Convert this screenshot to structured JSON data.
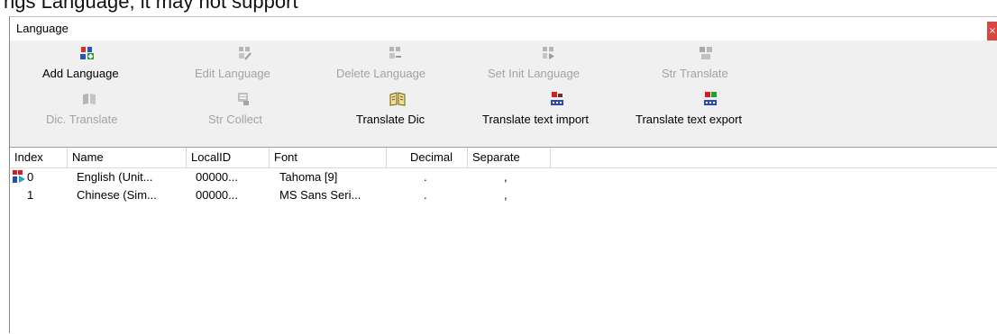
{
  "background_text": "ngs Language, it may not support",
  "window": {
    "title": "Language",
    "close_glyph": "×"
  },
  "toolbar": {
    "add_language": "Add Language",
    "edit_language": "Edit Language",
    "delete_language": "Delete Language",
    "set_init_language": "Set Init Language",
    "str_translate": "Str Translate",
    "dic_translate": "Dic. Translate",
    "str_collect": "Str Collect",
    "translate_dic": "Translate Dic",
    "translate_text_import": "Translate text import",
    "translate_text_export": "Translate text export"
  },
  "table": {
    "columns": [
      "Index",
      "Name",
      "LocalID",
      "Font",
      "Decimal",
      "Separate"
    ],
    "rows": [
      {
        "index": "0",
        "name": "English (Unit...",
        "localid": "00000...",
        "font": "Tahoma [9]",
        "decimal": ".",
        "separate": ",",
        "current": true
      },
      {
        "index": "1",
        "name": "Chinese (Sim...",
        "localid": "00000...",
        "font": "MS Sans Seri...",
        "decimal": ".",
        "separate": ",",
        "current": false
      }
    ]
  },
  "colors": {
    "accent_red": "#d9453f",
    "disabled_text": "#a3a3a3",
    "toolbar_bg": "#f0f0f0"
  }
}
